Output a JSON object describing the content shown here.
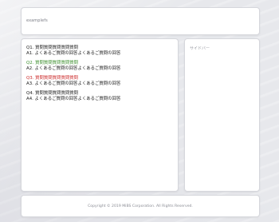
{
  "header": {
    "site_title": "examplefs"
  },
  "faq": [
    {
      "question": "Q1. 質問質問質問質問質問",
      "answer": "A1. よくあるご質問の回答よくあるご質問の回答",
      "question_color": "default"
    },
    {
      "question": "Q2. 質問質問質問質問質問",
      "answer": "A2. よくあるご質問の回答よくあるご質問の回答",
      "question_color": "green"
    },
    {
      "question": "Q3. 質問質問質問質問質問",
      "answer": "A3. よくあるご質問の回答よくあるご質問の回答",
      "question_color": "red"
    },
    {
      "question": "Q4. 質問質問質問質問質問",
      "answer": "A4. よくあるご質問の回答よくあるご質問の回答",
      "question_color": "default"
    }
  ],
  "sidebar": {
    "title": "サイドバー"
  },
  "footer": {
    "copyright": "Copyright © 2019 MiBS Corporation. All Rights Reserved."
  },
  "colors": {
    "question_green": "#3c8f2d",
    "question_red": "#cc2b2b",
    "panel_bg": "#ffffff",
    "page_bg": "#e7e8ec"
  }
}
